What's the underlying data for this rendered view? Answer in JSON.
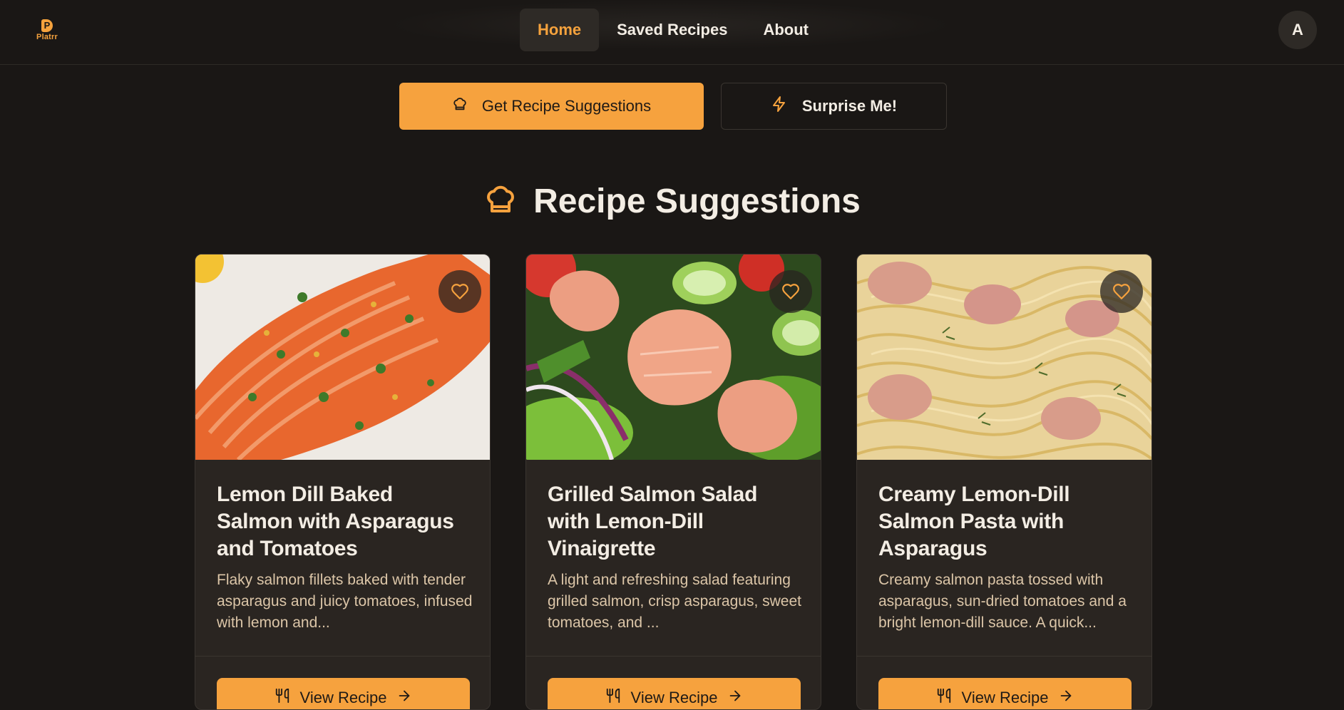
{
  "app": {
    "logo_text": "Platrr",
    "logo_letter": "P"
  },
  "nav": {
    "items": [
      {
        "label": "Home",
        "active": true
      },
      {
        "label": "Saved Recipes",
        "active": false
      },
      {
        "label": "About",
        "active": false
      }
    ]
  },
  "user": {
    "avatar_initial": "A"
  },
  "actions": {
    "primary_label": "Get Recipe Suggestions",
    "primary_icon": "chef-hat-icon",
    "secondary_label": "Surprise Me!",
    "secondary_icon": "lightning-icon"
  },
  "section": {
    "title": "Recipe Suggestions",
    "icon": "chef-hat-icon"
  },
  "recipes": [
    {
      "title": "Lemon Dill Baked Salmon with Asparagus and Tomatoes",
      "description": "Flaky salmon fillets baked with tender asparagus and juicy tomatoes, infused with lemon and...",
      "button_label": "View Recipe",
      "image": "baked-salmon-photo"
    },
    {
      "title": "Grilled Salmon Salad with Lemon-Dill Vinaigrette",
      "description": "A light and refreshing salad featuring grilled salmon, crisp asparagus, sweet tomatoes, and ...",
      "button_label": "View Recipe",
      "image": "salmon-salad-photo"
    },
    {
      "title": "Creamy Lemon-Dill Salmon Pasta with Asparagus",
      "description": "Creamy salmon pasta tossed with asparagus, sun-dried tomatoes and a bright lemon-dill sauce. A quick...",
      "button_label": "View Recipe",
      "image": "salmon-pasta-photo"
    }
  ],
  "colors": {
    "background": "#1a1715",
    "accent": "#f6a23e",
    "card": "#2a2521",
    "text": "#f3ede4",
    "muted_text": "#dcc6a8"
  }
}
